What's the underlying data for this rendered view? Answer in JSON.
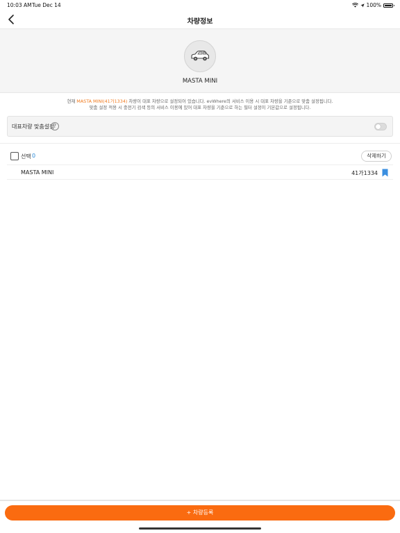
{
  "status_bar": {
    "time": "10:03 AM",
    "date": "Tue Dec 14",
    "battery": "100%"
  },
  "header": {
    "title": "차량정보"
  },
  "vehicle": {
    "name": "MASTA MINI"
  },
  "info": {
    "line1_prefix": "현재 ",
    "line1_highlight": "MASTA MINI(41가1334)",
    "line1_suffix": " 차량이 대표 차량으로 설정되어 있습니다.  evWhere의 서비스 이용 시 대표 차량을 기준으로 맞춤 설정됩니다.",
    "line2": "맞춤 설정 적용 시 충전기 검색 등의 서비스 이용에 있어 대표 차량을 기준으로 하는 필터 설정이 기본값으로 설정됩니다."
  },
  "setting": {
    "label": "대표차량 맞춤설정",
    "help": "?"
  },
  "list": {
    "select_label": "선택",
    "select_count": "0",
    "delete_label": "삭제하기",
    "rows": [
      {
        "name": "MASTA MINI",
        "plate": "41가1334"
      }
    ]
  },
  "footer": {
    "register_label": "+ 차량등록"
  },
  "colors": {
    "accent": "#fa6b10",
    "highlight": "#f07a1e",
    "link_blue": "#2a8ad8",
    "bookmark": "#3b8fe0"
  }
}
